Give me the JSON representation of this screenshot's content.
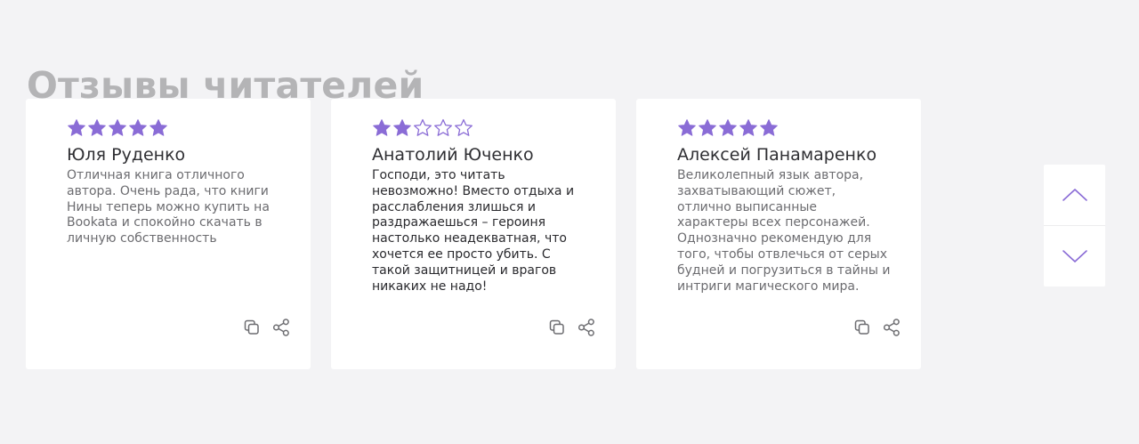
{
  "section": {
    "title": "Отзывы читателей"
  },
  "colors": {
    "background": "#f3f3f5",
    "card": "#ffffff",
    "star": "#8a6cd6",
    "title": "#b4b4b6",
    "icon": "#6c6c70",
    "arrow": "#8a6cd6"
  },
  "reviews": [
    {
      "rating": 5,
      "max_rating": 5,
      "name": "Юля Руденко",
      "text": "Отличная книга отличного автора. Очень рада, что книги Нины теперь можно купить на Bookata и спокойно скачать в личную собственность"
    },
    {
      "rating": 2,
      "max_rating": 5,
      "name": "Анатолий Юченко",
      "text": "Господи, это читать невозможно! Вместо отдыха и расслабления злишься и раздражаешься – героиня настолько неадекватная, что хочется ее просто убить. С такой защитницей и врагов никаких не надо!"
    },
    {
      "rating": 5,
      "max_rating": 5,
      "name": "Алексей Панамаренко",
      "text": "Великолепный язык автора, захватывающий сюжет, отлично выписанные характеры всех персонажей. Однозначно рекомендую для того, чтобы отвлечься от серых будней и погрузиться в тайны и интриги магического мира."
    }
  ],
  "icons": {
    "copy": "copy-icon",
    "share": "share-icon",
    "up": "chevron-up-icon",
    "down": "chevron-down-icon",
    "star_filled": "star-filled-icon",
    "star_empty": "star-outline-icon"
  }
}
